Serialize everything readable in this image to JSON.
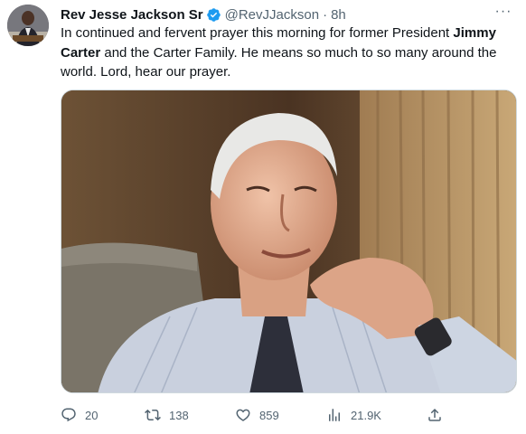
{
  "tweet": {
    "author_name": "Rev Jesse Jackson Sr",
    "handle": "@RevJJackson",
    "separator": "·",
    "time": "8h",
    "text_part1": "In continued and fervent prayer this morning for former President ",
    "text_bold1": "Jimmy",
    "text_bold2": "Carter",
    "text_part2": " and the Carter Family. He means so much to so many around the world. Lord, hear our prayer.",
    "more_label": "···"
  },
  "actions": {
    "replies": "20",
    "reposts": "138",
    "likes": "859",
    "views": "21.9K"
  },
  "colors": {
    "verified_badge": "#1d9bf0",
    "secondary_text": "#536471"
  },
  "icons": [
    "verified-badge-icon",
    "more-icon",
    "reply-icon",
    "repost-icon",
    "like-icon",
    "views-icon",
    "share-icon"
  ]
}
